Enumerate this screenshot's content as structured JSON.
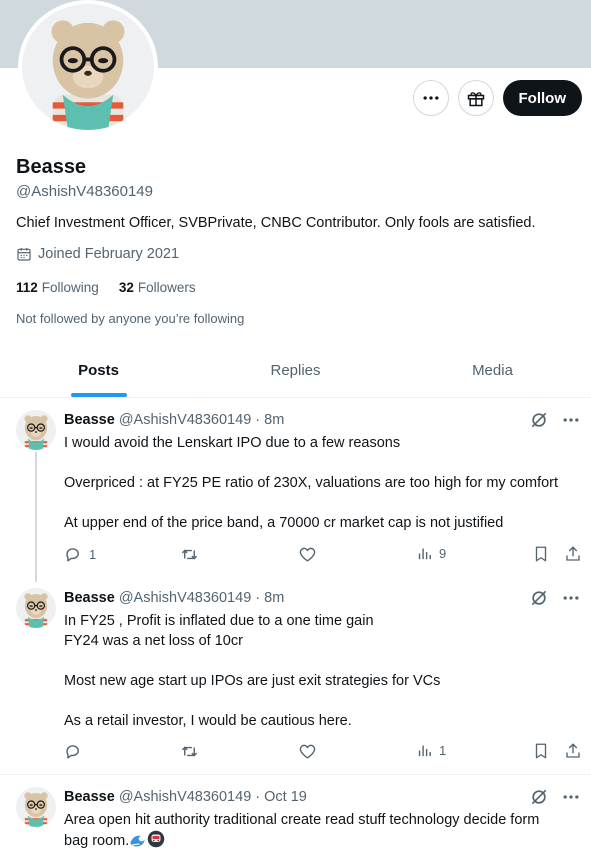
{
  "profile": {
    "name": "Beasse",
    "handle": "@AshishV48360149",
    "bio": "Chief Investment Officer, SVBPrivate, CNBC Contributor. Only fools are satisfied.",
    "joined": "Joined February 2021",
    "following_count": "112",
    "following_label": "Following",
    "followers_count": "32",
    "followers_label": "Followers",
    "not_followed": "Not followed by anyone you’re following",
    "follow_label": "Follow"
  },
  "tabs": [
    "Posts",
    "Replies",
    "Media"
  ],
  "tweets": [
    {
      "name": "Beasse",
      "meta": "@AshishV48360149 · 8m",
      "lines": [
        "I would avoid the Lenskart IPO due to a few reasons",
        "",
        "Overpriced :  at FY25 PE ratio of 230X, valuations are too high for my comfort",
        "",
        "At upper end of the price band, a 70000 cr market cap is not justified"
      ],
      "replies": "1",
      "views": "9"
    },
    {
      "name": "Beasse",
      "meta": "@AshishV48360149 · 8m",
      "lines": [
        "In FY25 , Profit is inflated  due to a one time gain",
        "FY24 was a net loss of 10cr",
        "",
        "Most new age start up IPOs are just exit strategies for VCs",
        "",
        "As a retail investor, I would be cautious here."
      ],
      "replies": "",
      "views": "1"
    },
    {
      "name": "Beasse",
      "meta": "@AshishV48360149 · Oct 19",
      "line1": "Area open hit authority traditional create read stuff technology decide form",
      "line2": "bag room."
    }
  ],
  "icons": {
    "more": "more-dots-icon",
    "gift": "gift-icon",
    "calendar": "calendar-icon",
    "grok": "grok-slash-icon",
    "reply": "reply-icon",
    "retweet": "retweet-icon",
    "like": "like-icon",
    "views": "views-icon",
    "bookmark": "bookmark-icon",
    "share": "share-icon"
  },
  "colors": {
    "accent": "#1d9bf0",
    "text": "#0f1419",
    "muted": "#536471",
    "banner": "#cfd9de"
  }
}
